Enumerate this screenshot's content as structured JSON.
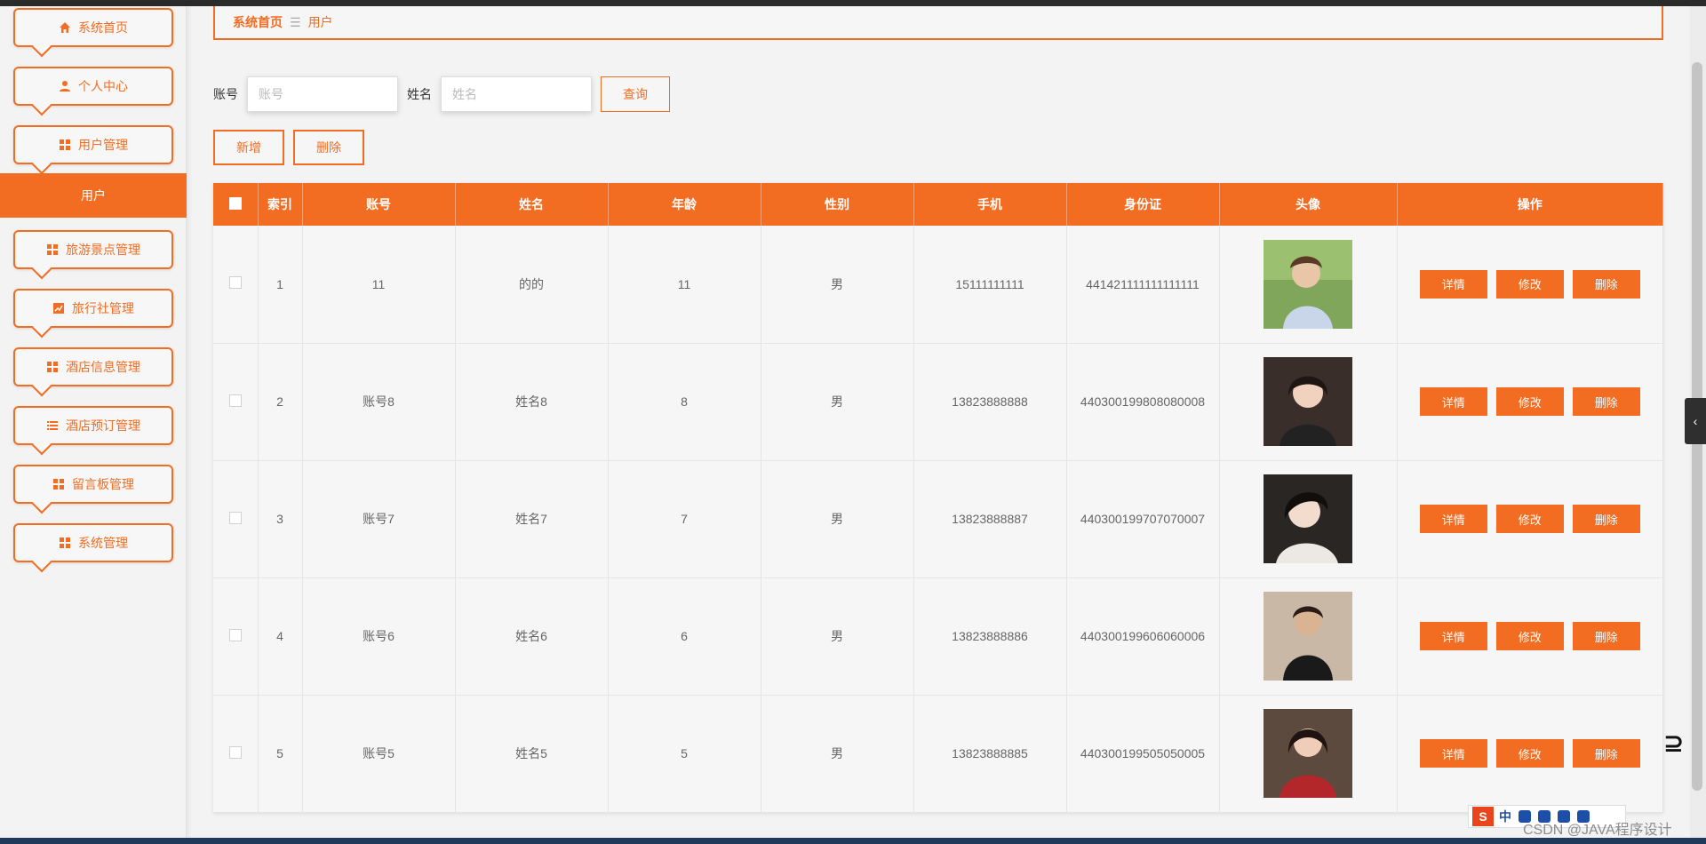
{
  "sidebar": {
    "items": [
      {
        "label": "系统首页",
        "icon": "home-icon"
      },
      {
        "label": "个人中心",
        "icon": "user-icon"
      },
      {
        "label": "用户管理",
        "icon": "grid-icon"
      },
      {
        "label": "旅游景点管理",
        "icon": "grid-icon"
      },
      {
        "label": "旅行社管理",
        "icon": "chart-icon"
      },
      {
        "label": "酒店信息管理",
        "icon": "grid-icon"
      },
      {
        "label": "酒店预订管理",
        "icon": "list-icon"
      },
      {
        "label": "留言板管理",
        "icon": "grid-icon"
      },
      {
        "label": "系统管理",
        "icon": "grid-icon"
      }
    ],
    "active_sub": "用户"
  },
  "breadcrumb": {
    "home": "系统首页",
    "separator": "☰",
    "current": "用户"
  },
  "search": {
    "account_label": "账号",
    "account_placeholder": "账号",
    "name_label": "姓名",
    "name_placeholder": "姓名",
    "query_label": "查询"
  },
  "actions": {
    "add_label": "新增",
    "delete_label": "删除"
  },
  "table": {
    "headers": [
      "",
      "索引",
      "账号",
      "姓名",
      "年龄",
      "性别",
      "手机",
      "身份证",
      "头像",
      "操作"
    ],
    "rows": [
      {
        "index": "1",
        "account": "11",
        "name": "的的",
        "age": "11",
        "gender": "男",
        "phone": "15111111111",
        "id_card": "441421111111111111"
      },
      {
        "index": "2",
        "account": "账号8",
        "name": "姓名8",
        "age": "8",
        "gender": "男",
        "phone": "13823888888",
        "id_card": "440300199808080008"
      },
      {
        "index": "3",
        "account": "账号7",
        "name": "姓名7",
        "age": "7",
        "gender": "男",
        "phone": "13823888887",
        "id_card": "440300199707070007"
      },
      {
        "index": "4",
        "account": "账号6",
        "name": "姓名6",
        "age": "6",
        "gender": "男",
        "phone": "13823888886",
        "id_card": "440300199606060006"
      },
      {
        "index": "5",
        "account": "账号5",
        "name": "姓名5",
        "age": "5",
        "gender": "男",
        "phone": "13823888885",
        "id_card": "440300199505050005"
      }
    ],
    "row_actions": {
      "detail": "详情",
      "edit": "修改",
      "delete": "删除"
    }
  },
  "overlay": {
    "ime_s": "S",
    "ime_zh": "中",
    "watermark": "CSDN @JAVA程序设计"
  },
  "colors": {
    "accent": "#f26c22",
    "background": "#f3f3f3"
  }
}
